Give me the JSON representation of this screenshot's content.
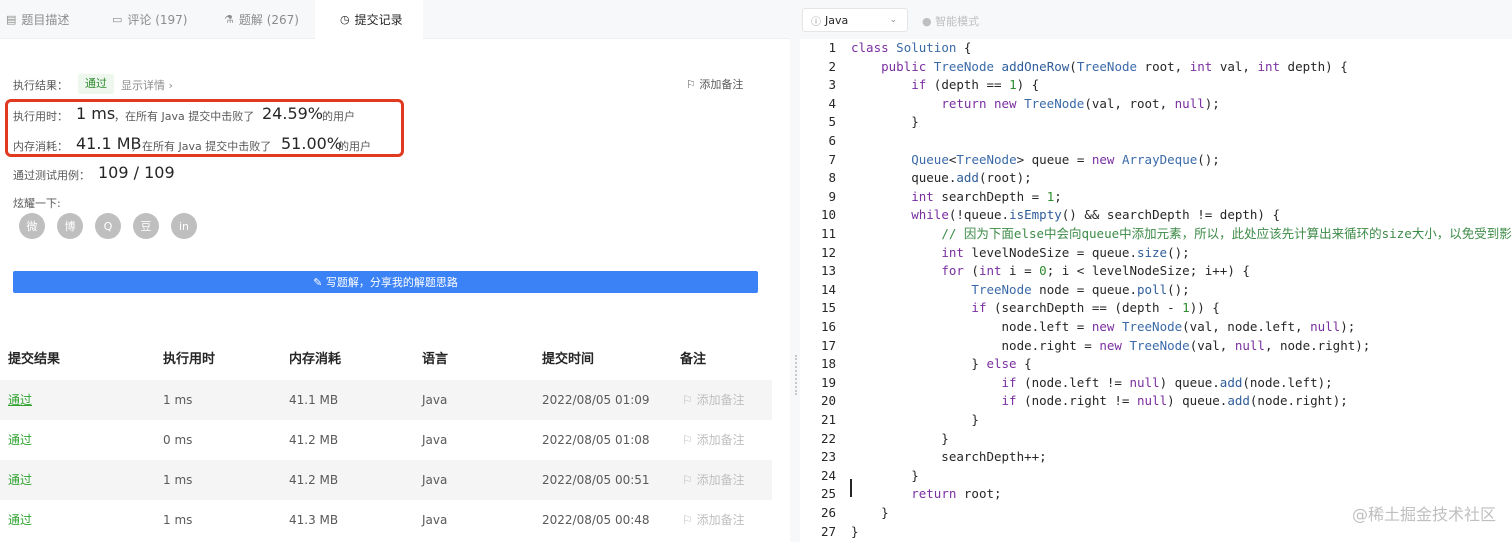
{
  "tabs": [
    {
      "label": "题目描述",
      "icon": "document-icon"
    },
    {
      "label": "评论 (197)",
      "icon": "comment-icon"
    },
    {
      "label": "题解 (267)",
      "icon": "flask-icon"
    },
    {
      "label": "提交记录",
      "icon": "clock-icon"
    }
  ],
  "result": {
    "exec_result_label": "执行结果：",
    "status": "通过",
    "detail_link": "显示详情 ›",
    "add_note": "添加备注",
    "time_label": "执行用时：",
    "time_value": "1 ms",
    "time_mid": "，在所有 Java 提交中击败了",
    "time_pct": "24.59%",
    "time_suffix": "的用户",
    "mem_label": "内存消耗：",
    "mem_value": "41.1 MB",
    "mem_mid": "，在所有 Java 提交中击败了",
    "mem_pct": "51.00%",
    "mem_suffix": "的用户",
    "tests_label": "通过测试用例：",
    "tests_value": "109 / 109",
    "share_label": "炫耀一下:",
    "share_icons": [
      "wechat-icon",
      "weibo-icon",
      "qq-icon",
      "douban-icon",
      "linkedin-icon"
    ],
    "share_glyphs": [
      "微",
      "博",
      "Q",
      "豆",
      "in"
    ],
    "write_button": "写题解，分享我的解题思路"
  },
  "submissions": {
    "headers": [
      "提交结果",
      "执行用时",
      "内存消耗",
      "语言",
      "提交时间",
      "备注"
    ],
    "rows": [
      {
        "status": "通过",
        "time": "1 ms",
        "memory": "41.1 MB",
        "lang": "Java",
        "submitted": "2022/08/05 01:09",
        "note": "添加备注"
      },
      {
        "status": "通过",
        "time": "0 ms",
        "memory": "41.2 MB",
        "lang": "Java",
        "submitted": "2022/08/05 01:08",
        "note": "添加备注"
      },
      {
        "status": "通过",
        "time": "1 ms",
        "memory": "41.2 MB",
        "lang": "Java",
        "submitted": "2022/08/05 00:51",
        "note": "添加备注"
      },
      {
        "status": "通过",
        "time": "1 ms",
        "memory": "41.3 MB",
        "lang": "Java",
        "submitted": "2022/08/05 00:48",
        "note": "添加备注"
      }
    ]
  },
  "editor": {
    "language": "Java",
    "smart_mode": "智能模式",
    "code": [
      "class Solution {",
      "    public TreeNode addOneRow(TreeNode root, int val, int depth) {",
      "        if (depth == 1) {",
      "            return new TreeNode(val, root, null);",
      "        }",
      "",
      "        Queue<TreeNode> queue = new ArrayDeque();",
      "        queue.add(root);",
      "        int searchDepth = 1;",
      "        while(!queue.isEmpty() && searchDepth != depth) {",
      "            // 因为下面else中会向queue中添加元素，所以，此处应该先计算出来循环的size大小，以免受到影响",
      "            int levelNodeSize = queue.size();",
      "            for (int i = 0; i < levelNodeSize; i++) {",
      "                TreeNode node = queue.poll();",
      "                if (searchDepth == (depth - 1)) {",
      "                    node.left = new TreeNode(val, node.left, null);",
      "                    node.right = new TreeNode(val, null, node.right);",
      "                } else {",
      "                    if (node.left != null) queue.add(node.left);",
      "                    if (node.right != null) queue.add(node.right);",
      "                }",
      "            }",
      "            searchDepth++;",
      "        }",
      "        return root;",
      "    }",
      "}"
    ]
  },
  "watermark": "@稀土掘金技术社区"
}
